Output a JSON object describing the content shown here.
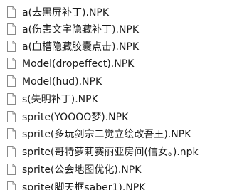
{
  "files": [
    {
      "name": "a(去黑屏补丁).NPK"
    },
    {
      "name": "a(伤害文字隐藏补丁).NPK"
    },
    {
      "name": "a(血槽隐藏胶囊点击).NPK"
    },
    {
      "name": "Model(dropeffect).NPK"
    },
    {
      "name": "Model(hud).NPK"
    },
    {
      "name": "s(失明补丁).NPK"
    },
    {
      "name": "sprite(YOOOO梦).NPK"
    },
    {
      "name": "sprite(多玩剑宗二觉立绘改吾王).NPK"
    },
    {
      "name": "sprite(哥特萝莉赛丽亚房间(信女。).npk"
    },
    {
      "name": "sprite(公会地图优化).NPK"
    },
    {
      "name": "sprite(脚天框saber1).NPK"
    }
  ],
  "icon": "blank-file-icon"
}
